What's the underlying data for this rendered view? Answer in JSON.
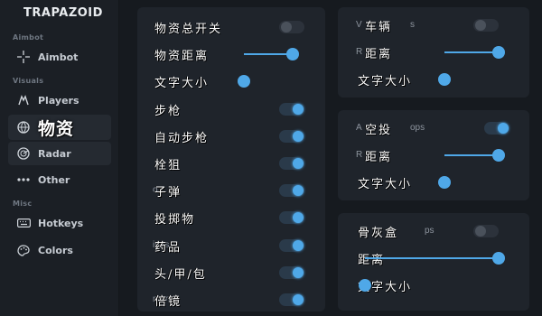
{
  "brand": "TRAPAZOID",
  "sidebar": {
    "sections": [
      {
        "label": "Aimbot",
        "items": [
          {
            "label": "Aimbot",
            "icon": "crosshair-icon"
          }
        ]
      },
      {
        "label": "Visuals",
        "items": [
          {
            "label": "Players",
            "icon": "players-icon"
          },
          {
            "label": "物资",
            "icon": "globe-icon"
          },
          {
            "label": "Radar",
            "icon": "radar-icon"
          },
          {
            "label": "Other",
            "icon": "more-icon"
          }
        ]
      },
      {
        "label": "Misc",
        "items": [
          {
            "label": "Hotkeys",
            "icon": "keyboard-icon"
          },
          {
            "label": "Colors",
            "icon": "palette-icon"
          }
        ]
      }
    ]
  },
  "left_panel": {
    "rows": [
      {
        "label": "物资总开关",
        "control": "toggle",
        "on": false
      },
      {
        "label": "物资距离",
        "control": "slider",
        "value": 1.0
      },
      {
        "label": "文字大小",
        "control": "slider",
        "value": 0.0
      },
      {
        "label": "步枪",
        "control": "toggle",
        "on": true
      },
      {
        "label": "自动步枪",
        "control": "toggle",
        "on": true
      },
      {
        "label": "栓狙",
        "control": "toggle",
        "on": true
      },
      {
        "label": "子弹",
        "ghost": "o",
        "control": "toggle",
        "on": true
      },
      {
        "label": "投掷物",
        "control": "toggle",
        "on": true
      },
      {
        "label": "药品",
        "ghost": "ines",
        "control": "toggle",
        "on": true
      },
      {
        "label": "头/甲/包",
        "control": "toggle",
        "on": true
      },
      {
        "label": "倍镜",
        "ghost": "mens",
        "control": "toggle",
        "on": true
      }
    ]
  },
  "vehicles_panel": {
    "rows": [
      {
        "label": "车辆",
        "ghost": "V",
        "ghost_suffix": "s",
        "control": "toggle",
        "on": false
      },
      {
        "label": "距离",
        "ghost": "R",
        "control": "slider",
        "value": 1.0
      },
      {
        "label": "文字大小",
        "control": "slider",
        "value": 0.0
      }
    ]
  },
  "airdrop_panel": {
    "rows": [
      {
        "label": "空投",
        "ghost": "A",
        "ghost_suffix": "ops",
        "control": "toggle",
        "on": true
      },
      {
        "label": "距离",
        "ghost": "R",
        "control": "slider",
        "value": 1.0
      },
      {
        "label": "文字大小",
        "control": "slider",
        "value": 0.0
      }
    ]
  },
  "deathbox_panel": {
    "rows": [
      {
        "label": "骨灰盒",
        "ghost_suffix": "ps",
        "control": "toggle",
        "on": false
      },
      {
        "label": "距离",
        "control": "slider",
        "value": 1.0
      },
      {
        "label": "文字大小",
        "control": "slider",
        "value": 0.0
      }
    ]
  },
  "colors": {
    "accent": "#4fa8e8",
    "panel": "#1f242b",
    "background": "#161a1f"
  }
}
